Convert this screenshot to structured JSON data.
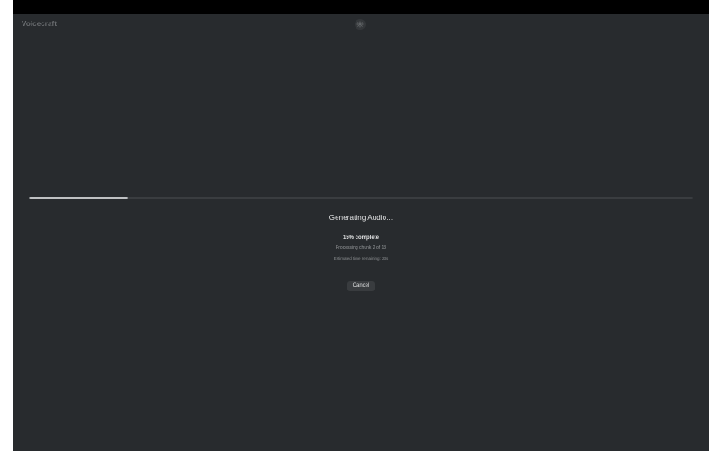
{
  "app": {
    "name": "Voicecraft"
  },
  "header": {
    "settings_icon": "gear-icon"
  },
  "progress": {
    "percent": 15,
    "heading": "Generating Audio...",
    "percent_label": "15% complete",
    "chunk_label": "Processing chunk 2 of 13",
    "eta_label": "Estimated time remaining: 23s"
  },
  "actions": {
    "cancel_label": "Cancel"
  },
  "colors": {
    "background": "#282b2e",
    "progress_fill": "#bfc1c3",
    "progress_track": "#3a3d40"
  }
}
